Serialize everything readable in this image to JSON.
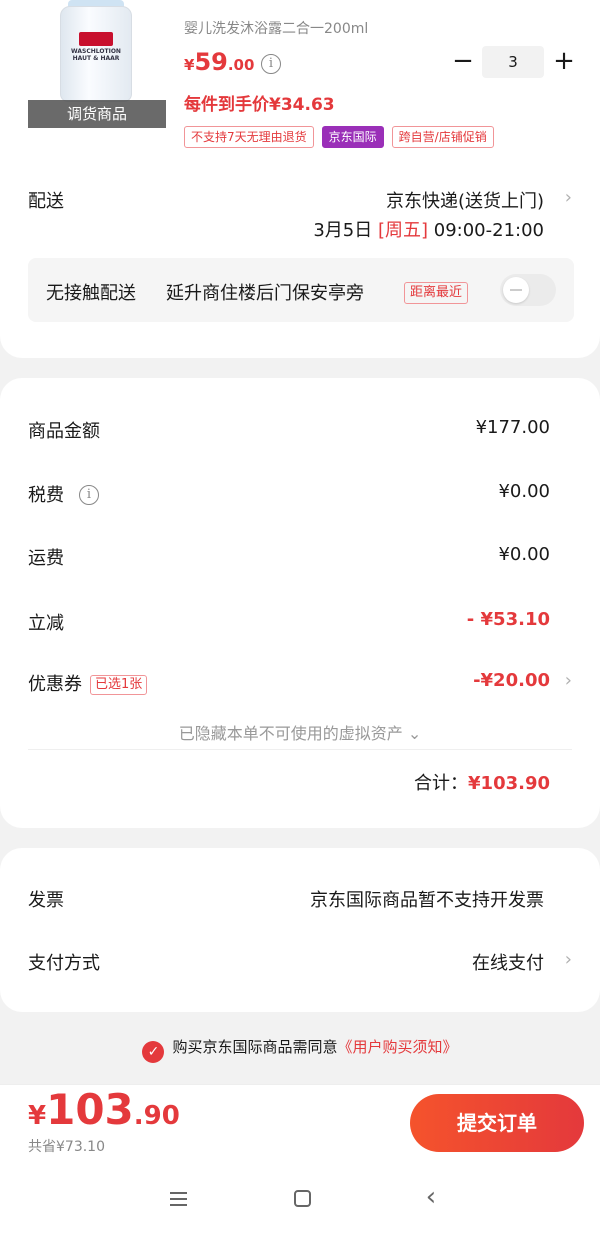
{
  "product": {
    "title": "婴儿洗发沐浴露二合一200ml",
    "image_tag": "调货商品",
    "bottle_label_brand": "sebamed",
    "bottle_label_text": "WASCHLOTION HAUT & HAAR",
    "price_currency": "¥",
    "price_int": "59",
    "price_dec": ".00",
    "final_price_text": "每件到手价¥34.63",
    "badges": [
      "不支持7天无理由退货",
      "京东国际",
      "跨自营/店铺促销"
    ],
    "quantity": "3",
    "minus": "−",
    "plus": "+"
  },
  "shipping": {
    "label": "配送",
    "method": "京东快递(送货上门)",
    "date": "3月5日",
    "weekday": "[周五]",
    "time": "09:00-21:00"
  },
  "contactless": {
    "title": "无接触配送",
    "location": "延升商住楼后门保安亭旁",
    "tag": "距离最近"
  },
  "costs": {
    "goods_label": "商品金额",
    "goods_value": "¥177.00",
    "tax_label": "税费",
    "tax_value": "¥0.00",
    "freight_label": "运费",
    "freight_value": "¥0.00",
    "discount_label": "立减",
    "discount_value": "- ¥53.10",
    "coupon_label": "优惠券",
    "coupon_badge": "已选1张",
    "coupon_value": "-¥20.00",
    "hidden_note": "已隐藏本单不可使用的虚拟资产 ⌄",
    "total_label": "合计：",
    "total_value": "¥103.90"
  },
  "invoice": {
    "label": "发票",
    "value": "京东国际商品暂不支持开发票"
  },
  "payment": {
    "label": "支付方式",
    "value": "在线支付"
  },
  "agreement": {
    "text": "购买京东国际商品需同意",
    "link": "《用户购买须知》"
  },
  "bottom": {
    "currency": "¥",
    "total_int": "103",
    "total_dec": ".90",
    "saved": "共省¥73.10",
    "submit": "提交订单"
  },
  "icons": {
    "info": "i",
    "chevron": "›",
    "check": "✓",
    "back": "‹"
  },
  "colors": {
    "accent": "#e4393c",
    "purple_badge": "#9a2fb8"
  }
}
